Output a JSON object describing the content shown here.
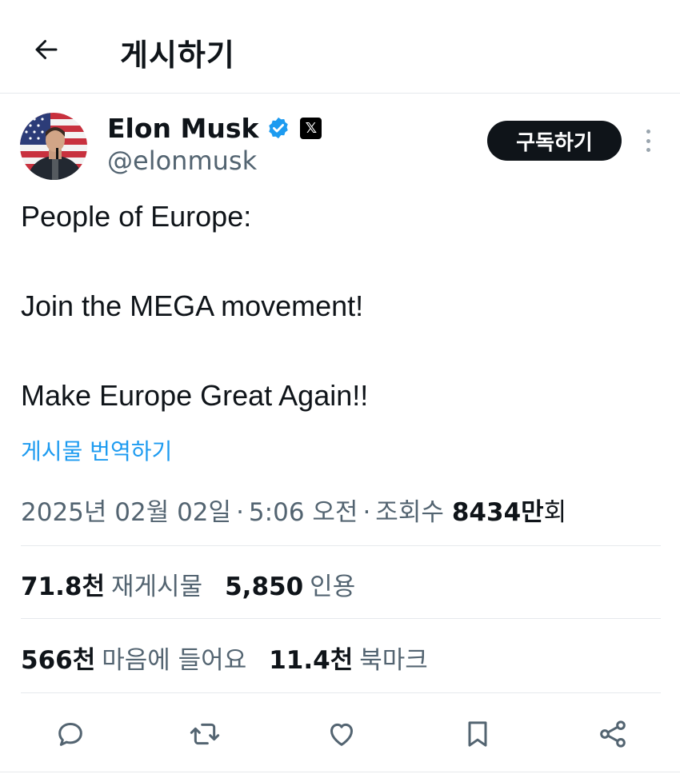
{
  "header": {
    "title": "게시하기"
  },
  "author": {
    "name": "Elon Musk",
    "handle": "@elonmusk",
    "x_badge": "𝕏"
  },
  "subscribe_label": "구독하기",
  "tweet": {
    "lines": [
      "People of Europe:",
      "Join the MEGA movement!",
      "Make Europe Great Again!!"
    ]
  },
  "translate_label": "게시물 번역하기",
  "meta": {
    "date": "2025년 02월 02일",
    "separator": "·",
    "time": "5:06 오전",
    "views_label": "조회수",
    "views_number": "8434",
    "views_unit": "만",
    "views_suffix": "회"
  },
  "stats": {
    "reposts_num": "71.8천",
    "reposts_label": "재게시물",
    "quotes_num": "5,850",
    "quotes_label": "인용",
    "likes_num": "566천",
    "likes_label": "마음에 들어요",
    "bookmarks_num": "11.4천",
    "bookmarks_label": "북마크"
  },
  "icons": {
    "back": "arrow-left-icon",
    "verified": "verified-badge-icon",
    "reply": "reply-icon",
    "repost": "repost-icon",
    "like": "heart-icon",
    "bookmark": "bookmark-icon",
    "share": "share-icon"
  },
  "colors": {
    "accent": "#1d9bf0",
    "text": "#0f1419",
    "secondary": "#536471"
  }
}
